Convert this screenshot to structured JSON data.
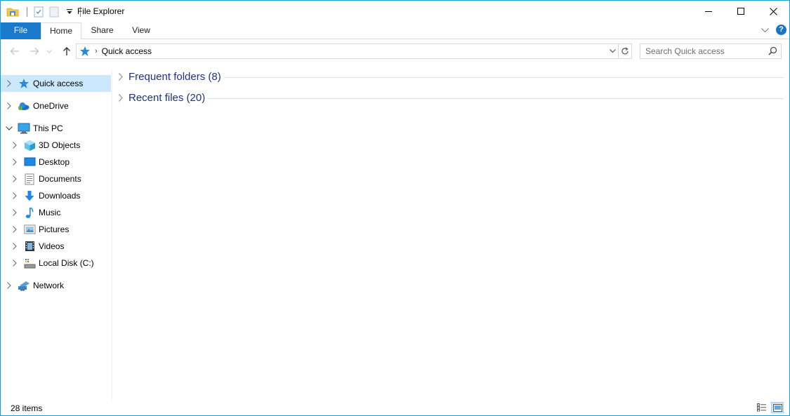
{
  "window": {
    "title": "File Explorer"
  },
  "ribbon": {
    "tabs": [
      {
        "label": "File"
      },
      {
        "label": "Home"
      },
      {
        "label": "Share"
      },
      {
        "label": "View"
      }
    ],
    "help_label": "?"
  },
  "address_bar": {
    "location": "Quick access",
    "separator": "›"
  },
  "search": {
    "placeholder": "Search Quick access",
    "value": ""
  },
  "sidebar": {
    "items": [
      {
        "label": "Quick access",
        "icon": "star-icon",
        "selected": true
      },
      {
        "label": "OneDrive",
        "icon": "onedrive-cloud-icon"
      },
      {
        "label": "This PC",
        "icon": "computer-icon",
        "expanded": true
      },
      {
        "label": "3D Objects",
        "icon": "cube-icon"
      },
      {
        "label": "Desktop",
        "icon": "desktop-icon"
      },
      {
        "label": "Documents",
        "icon": "document-icon"
      },
      {
        "label": "Downloads",
        "icon": "download-arrow-icon"
      },
      {
        "label": "Music",
        "icon": "music-note-icon"
      },
      {
        "label": "Pictures",
        "icon": "picture-icon"
      },
      {
        "label": "Videos",
        "icon": "film-icon"
      },
      {
        "label": "Local Disk (C:)",
        "icon": "drive-icon"
      },
      {
        "label": "Network",
        "icon": "network-icon"
      }
    ]
  },
  "content": {
    "groups": [
      {
        "title": "Frequent folders (8)"
      },
      {
        "title": "Recent files (20)"
      }
    ]
  },
  "status": {
    "item_count": "28 items"
  },
  "colors": {
    "accent": "#1979ca",
    "selection": "#cce8ff",
    "group_title": "#1e3287"
  }
}
